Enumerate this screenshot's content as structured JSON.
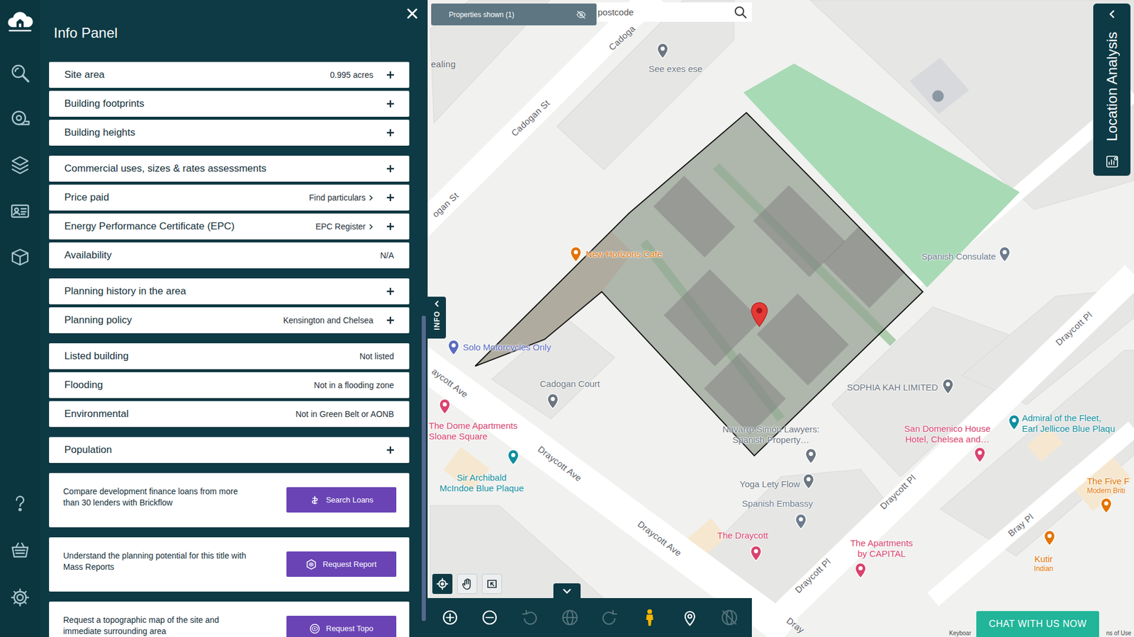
{
  "panel": {
    "title": "Info Panel",
    "groups": [
      [
        {
          "label": "Site area",
          "value": "0.995 acres",
          "value_kind": "plain",
          "expandable": true
        },
        {
          "label": "Building footprints",
          "expandable": true
        },
        {
          "label": "Building heights",
          "expandable": true
        }
      ],
      [
        {
          "label": "Commercial uses, sizes & rates assessments",
          "expandable": true
        },
        {
          "label": "Price paid",
          "value": "Find particulars",
          "value_kind": "link",
          "expandable": true
        },
        {
          "label": "Energy Performance Certificate (EPC)",
          "value": "EPC Register",
          "value_kind": "link",
          "expandable": true
        },
        {
          "label": "Availability",
          "value": "N/A",
          "value_kind": "plain",
          "expandable": false
        }
      ],
      [
        {
          "label": "Planning history in the area",
          "expandable": true
        },
        {
          "label": "Planning policy",
          "value": "Kensington and Chelsea",
          "value_kind": "plain",
          "expandable": true
        }
      ],
      [
        {
          "label": "Listed building",
          "value": "Not listed",
          "value_kind": "plain",
          "expandable": false
        },
        {
          "label": "Flooding",
          "value": "Not in a flooding zone",
          "value_kind": "plain",
          "expandable": false
        },
        {
          "label": "Environmental",
          "value": "Not in Green Belt or AONB",
          "value_kind": "plain",
          "expandable": false
        }
      ],
      [
        {
          "label": "Population",
          "expandable": true
        }
      ]
    ],
    "promos": [
      {
        "lines": [
          "Compare development finance loans from more",
          "than 30 lenders with Brickflow"
        ],
        "button": "Search Loans"
      },
      {
        "lines": [
          "Understand the planning potential for this title with",
          "Mass Reports"
        ],
        "button": "Request Report"
      },
      {
        "lines": [
          "Request a topographic map of the site and",
          "immediate surrounding area"
        ],
        "button": "Request Topo"
      }
    ],
    "scrollbar": {
      "level": 0.48
    }
  },
  "info_tab": {
    "label": "INFO"
  },
  "location_tab": {
    "label": "Location Analysis"
  },
  "map": {
    "properties_badge": "Properties shown (1)",
    "search": {
      "placeholder": "postcode"
    },
    "places": [
      {
        "lines": [
          "See exes ese"
        ],
        "color": "#6b7680"
      },
      {
        "lines": [
          "New Horizons Cafe"
        ],
        "color": "#e37400"
      },
      {
        "lines": [
          "Solo Motorcycles Only"
        ],
        "color": "#5b6bbf"
      },
      {
        "lines": [
          "Cadogan Court"
        ],
        "color": "#6b7680"
      },
      {
        "lines": [
          "The Dome Apartments",
          "Sloane Square"
        ],
        "color": "#d9436f"
      },
      {
        "lines": [
          "Sir Archibald",
          "McIndoe Blue Plaque"
        ],
        "color": "#0f8f9e"
      },
      {
        "lines": [
          "Spanish Consulate"
        ],
        "color": "#6d7c8e"
      },
      {
        "lines": [
          "SOPHIA KAH LIMITED"
        ],
        "color": "#6b7680"
      },
      {
        "lines": [
          "Navarro Simón Lawyers:",
          "Spanish Property…"
        ],
        "color": "#6b7680"
      },
      {
        "lines": [
          "Yoga Lety Flow"
        ],
        "color": "#6b7680"
      },
      {
        "lines": [
          "Spanish Embassy"
        ],
        "color": "#6d7c8e"
      },
      {
        "lines": [
          "The Draycott"
        ],
        "color": "#d9436f"
      },
      {
        "lines": [
          "The Apartments",
          "by CAPITAL"
        ],
        "color": "#d9436f"
      },
      {
        "lines": [
          "San Domenico House",
          "Hotel, Chelsea and…"
        ],
        "color": "#d9436f"
      },
      {
        "lines": [
          "Admiral of the Fleet,",
          "Earl Jellicoe Blue Plaqu"
        ],
        "color": "#0f8f9e"
      },
      {
        "lines": [
          "The Five F"
        ],
        "sub": "Modern Briti",
        "color": "#e37400"
      },
      {
        "lines": [
          "Kutir"
        ],
        "sub": "Indian",
        "color": "#e37400"
      }
    ],
    "labels": [
      "Cadoga",
      "Cadogan St",
      "ogan St",
      "aycott Ave",
      "Draycott Ave",
      "Draycott Ave",
      "Draycott Pl",
      "Draycott Pl",
      "Draycott Pl",
      "Bray Pl",
      "Dray",
      "ealing"
    ]
  },
  "map_tools": [
    {
      "selected": true
    },
    {
      "selected": false
    },
    {
      "selected": false
    }
  ],
  "toolbar": {
    "items": [
      {
        "enabled": true
      },
      {
        "enabled": true
      },
      {
        "enabled": false
      },
      {
        "enabled": false
      },
      {
        "enabled": false
      },
      {
        "enabled": true
      },
      {
        "enabled": true
      },
      {
        "enabled": false
      }
    ]
  },
  "chat_button": "CHAT WITH US NOW",
  "footer": [
    "Keyboar",
    "ns of Use"
  ]
}
